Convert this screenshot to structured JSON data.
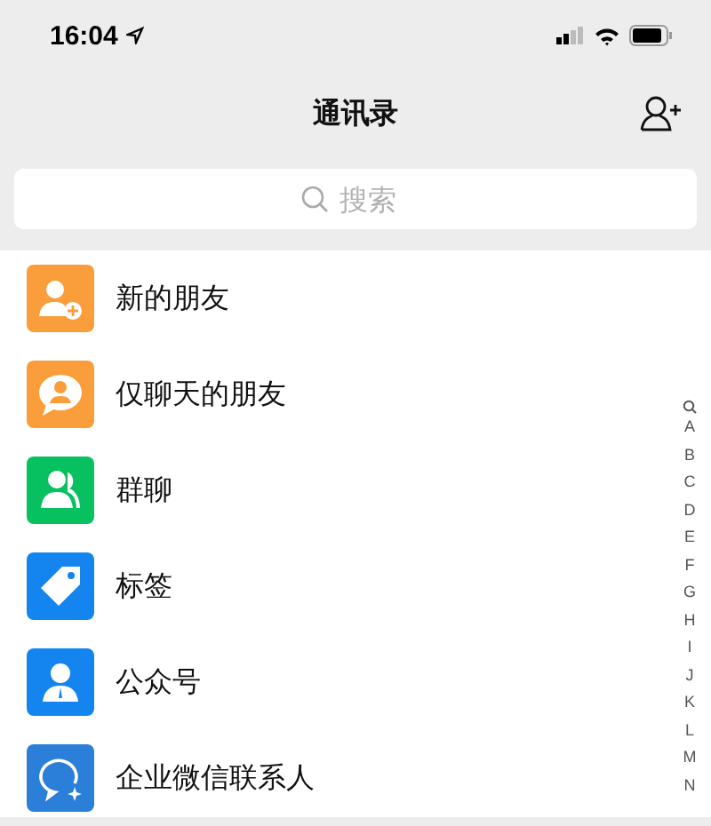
{
  "status_bar": {
    "time": "16:04"
  },
  "nav": {
    "title": "通讯录"
  },
  "search": {
    "placeholder": "搜索"
  },
  "items": [
    {
      "label": "新的朋友",
      "kind": "add-person",
      "color": "#fa9d3b"
    },
    {
      "label": "仅聊天的朋友",
      "kind": "chat-person",
      "color": "#fa9d3b"
    },
    {
      "label": "群聊",
      "kind": "group",
      "color": "#07c160"
    },
    {
      "label": "标签",
      "kind": "tag",
      "color": "#1485ee"
    },
    {
      "label": "公众号",
      "kind": "official",
      "color": "#1485ee"
    },
    {
      "label": "企业微信联系人",
      "kind": "work-chat",
      "color": "#2b7fd9"
    }
  ],
  "index": [
    "A",
    "B",
    "C",
    "D",
    "E",
    "F",
    "G",
    "H",
    "I",
    "J",
    "K",
    "L",
    "M",
    "N"
  ]
}
